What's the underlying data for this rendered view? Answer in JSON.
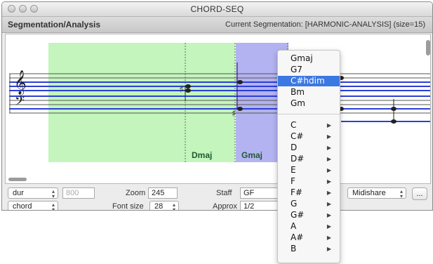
{
  "window": {
    "title": "CHORD-SEQ"
  },
  "header": {
    "mode": "Segmentation/Analysis",
    "status": "Current Segmentation:  [HARMONIC-ANALYSIS] (size=15)"
  },
  "score": {
    "segment_labels": [
      "Dmaj",
      "Gmaj"
    ]
  },
  "controls": {
    "row1": {
      "dur_select": "dur",
      "dur_value": "800",
      "zoom_label": "Zoom",
      "zoom_value": "245",
      "staff_label": "Staff",
      "staff_value": "GF",
      "midi_select": "Midishare",
      "more_button": "..."
    },
    "row2": {
      "chord_select": "chord",
      "fontsize_label": "Font size",
      "fontsize_value": "28",
      "approx_label": "Approx",
      "approx_value": "1/2"
    }
  },
  "context_menu": {
    "top_items": [
      "Gmaj",
      "G7",
      "C#hdim",
      "Bm",
      "Gm"
    ],
    "selected": "C#hdim",
    "roots": [
      "C",
      "C#",
      "D",
      "D#",
      "E",
      "F",
      "F#",
      "G",
      "G#",
      "A",
      "A#",
      "B"
    ]
  },
  "colors": {
    "segment_green": "#c3f5bd",
    "segment_blue": "#b3b3f1",
    "staff_blue": "#2c3fd6",
    "menu_highlight": "#3b78e2"
  }
}
